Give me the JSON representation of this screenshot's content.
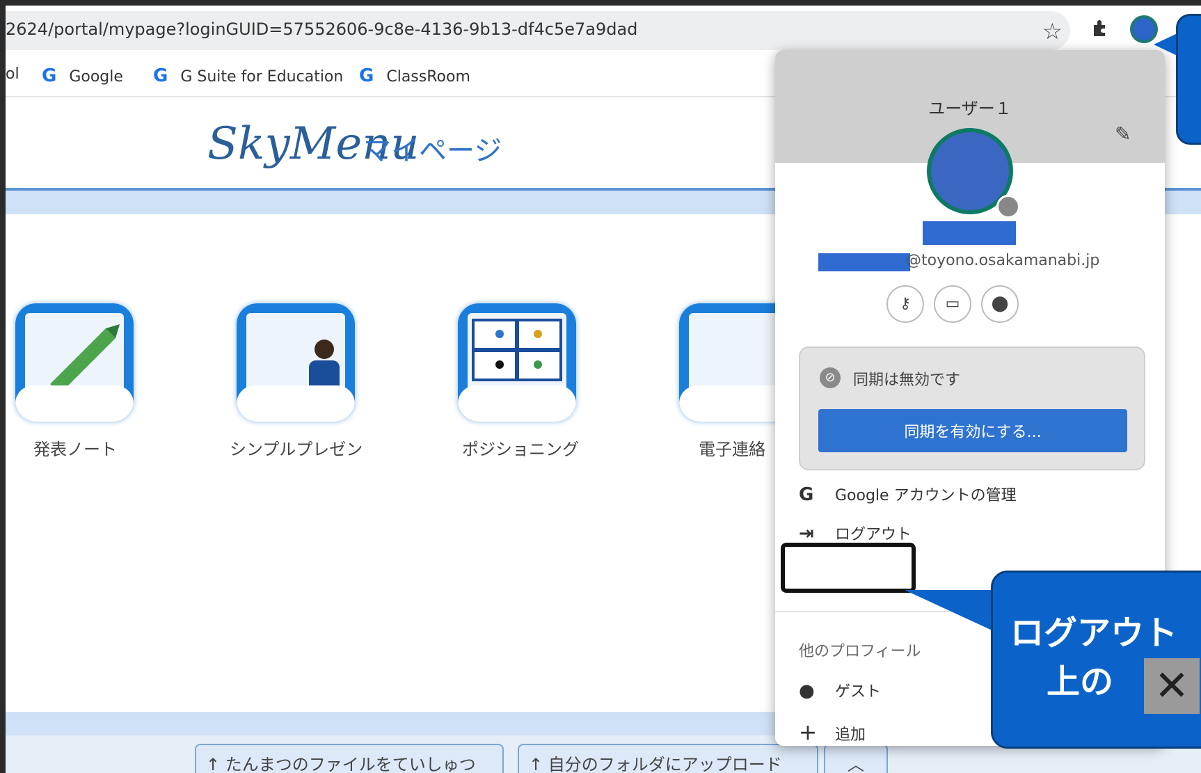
{
  "browser": {
    "url": "2624/portal/mypage?loginGUID=57552606-9c8e-4136-9b13-df4c5e7a9dad",
    "bookmarks": [
      {
        "label": "ol",
        "icon": ""
      },
      {
        "label": "Google",
        "icon": "G"
      },
      {
        "label": "G Suite for Education",
        "icon": "G"
      },
      {
        "label": "ClassRoom",
        "icon": "G"
      }
    ]
  },
  "site": {
    "logo_text": "SkyMenu",
    "logo_sub": "マイページ"
  },
  "apps": [
    {
      "label": "発表ノート"
    },
    {
      "label": "シンプルプレゼン"
    },
    {
      "label": "ポジショニング"
    },
    {
      "label": "電子連絡"
    }
  ],
  "bottom_buttons": [
    {
      "label": "たんまつのファイルをていしゅつ",
      "icon": "↑"
    },
    {
      "label": "自分のフォルダにアップロード",
      "icon": "↑"
    }
  ],
  "profile": {
    "name": "ユーザー１",
    "email": "@toyono.osakamanabi.jp",
    "sync_status": "同期は無効です",
    "sync_button": "同期を有効にする...",
    "manage_account": "Google アカウントの管理",
    "logout": "ログアウト",
    "other_profiles_title": "他のプロフィール",
    "guest": "ゲスト",
    "add": "追加"
  },
  "callout": {
    "line1": "ログアウト",
    "line2": "上の",
    "close_glyph": "✕"
  }
}
